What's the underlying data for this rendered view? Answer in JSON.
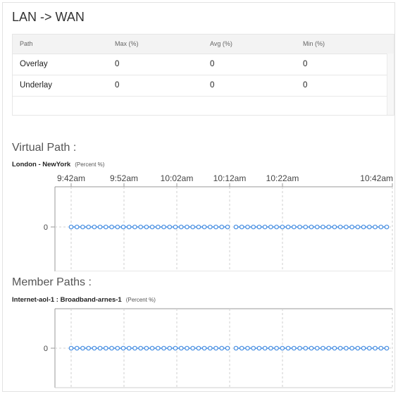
{
  "panel": {
    "title": "LAN -> WAN"
  },
  "table": {
    "headers": [
      "Path",
      "Max (%)",
      "Avg (%)",
      "Min (%)"
    ],
    "rows": [
      [
        "Overlay",
        "0",
        "0",
        "0"
      ],
      [
        "Underlay",
        "0",
        "0",
        "0"
      ]
    ]
  },
  "virtual_path": {
    "section_title": "Virtual Path :",
    "chart_title": "London - NewYork",
    "unit": "(Percent %)",
    "x_ticks": [
      "9:42am",
      "9:52am",
      "10:02am",
      "10:12am",
      "10:22am",
      "10:42am"
    ],
    "y_tick": "0"
  },
  "member_paths": {
    "section_title": "Member Paths :",
    "chart_title": "Internet-aol-1 : Broadband-arnes-1",
    "unit": "(Percent %)",
    "y_tick": "0"
  },
  "colors": {
    "series": "#4a90e2",
    "grid": "#cfcfcf",
    "axis": "#999999"
  },
  "chart_data": [
    {
      "type": "line",
      "title": "London - NewYork",
      "ylabel": "(Percent %)",
      "x": [
        "9:42am",
        "9:52am",
        "10:02am",
        "10:12am",
        "10:22am",
        "10:42am"
      ],
      "series": [
        {
          "values": [
            0,
            0,
            0,
            0,
            0,
            0
          ]
        }
      ],
      "points_segment_1": 28,
      "points_segment_2": 27,
      "grid": true
    },
    {
      "type": "line",
      "title": "Internet-aol-1 : Broadband-arnes-1",
      "ylabel": "(Percent %)",
      "series": [
        {
          "values": [
            0,
            0,
            0,
            0,
            0,
            0
          ]
        }
      ],
      "points_segment_1": 28,
      "points_segment_2": 27,
      "grid": true
    }
  ]
}
